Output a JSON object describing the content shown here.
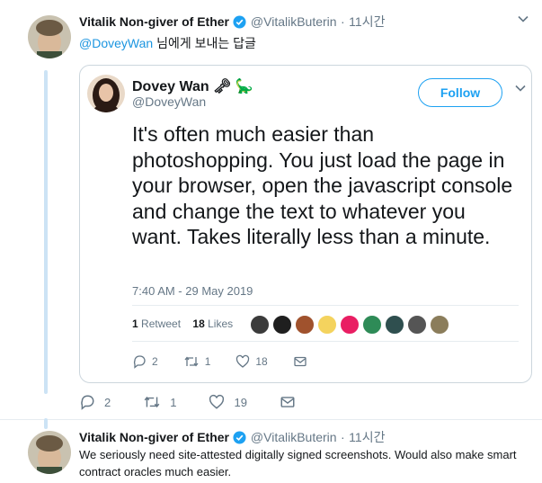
{
  "tweet1": {
    "author_name": "Vitalik Non-giver of Ether",
    "author_handle": "@VitalikButerin",
    "separator": "·",
    "time": "11시간",
    "reply_mention": "@DoveyWan",
    "reply_suffix": "님에게 보내는 답글",
    "actions": {
      "replies": "2",
      "retweets": "1",
      "likes": "19"
    }
  },
  "quoted": {
    "name": "Dovey Wan",
    "emoji": "🗝 🦕",
    "handle": "@DoveyWan",
    "follow_label": "Follow",
    "text": "It's often much easier than photoshopping. You just load the page in your browser, open the javascript console and change the text to whatever you want. Takes literally less than a minute.",
    "timestamp": "7:40 AM - 29 May 2019",
    "retweets_count": "1",
    "retweets_label": "Retweet",
    "likes_count": "18",
    "likes_label": "Likes",
    "liker_colors": [
      "#3b3b3b",
      "#1f1f1f",
      "#a0522d",
      "#f4d35e",
      "#e91e63",
      "#2e8b57",
      "#2f4f4f",
      "#555555",
      "#8b7d5b"
    ],
    "actions": {
      "replies": "2",
      "retweets": "1",
      "likes": "18"
    }
  },
  "tweet2": {
    "author_name": "Vitalik Non-giver of Ether",
    "author_handle": "@VitalikButerin",
    "separator": "·",
    "time": "11시간",
    "text": "We seriously need site-attested digitally signed screenshots. Would also make smart contract oracles much easier."
  },
  "colors": {
    "accent": "#1da1f2",
    "mention": "#1b95e0",
    "muted": "#657786",
    "thread_line": "#cce3f5"
  }
}
